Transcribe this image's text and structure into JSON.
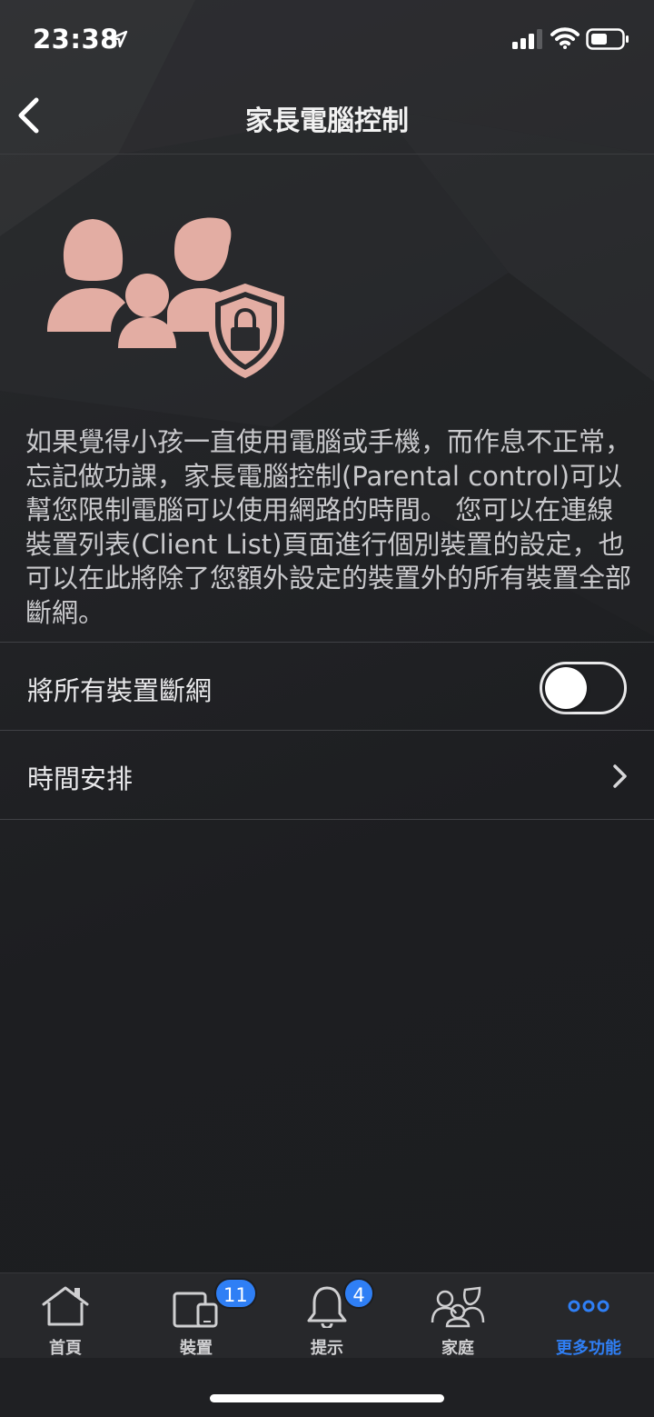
{
  "status_bar": {
    "time": "23:38"
  },
  "nav": {
    "title": "家長電腦控制"
  },
  "description": "如果覺得小孩一直使用電腦或手機，而作息不正常，忘記做功課，家長電腦控制(Parental control)可以幫您限制電腦可以使用網路的時間。 您可以在連線裝置列表(Client List)頁面進行個別裝置的設定，也可以在此將除了您額外設定的裝置外的所有裝置全部斷網。",
  "settings": {
    "block_all_label": "將所有裝置斷網",
    "block_all_enabled": false,
    "schedule_label": "時間安排"
  },
  "tabs": [
    {
      "label": "首頁",
      "icon": "home-icon"
    },
    {
      "label": "裝置",
      "icon": "devices-icon",
      "badge": "11"
    },
    {
      "label": "提示",
      "icon": "bell-icon",
      "badge": "4"
    },
    {
      "label": "家庭",
      "icon": "family-icon"
    },
    {
      "label": "更多功能",
      "icon": "more-icon",
      "active": true
    }
  ],
  "colors": {
    "accent": "#2f7ff5",
    "illustration": "#e3ada3"
  }
}
